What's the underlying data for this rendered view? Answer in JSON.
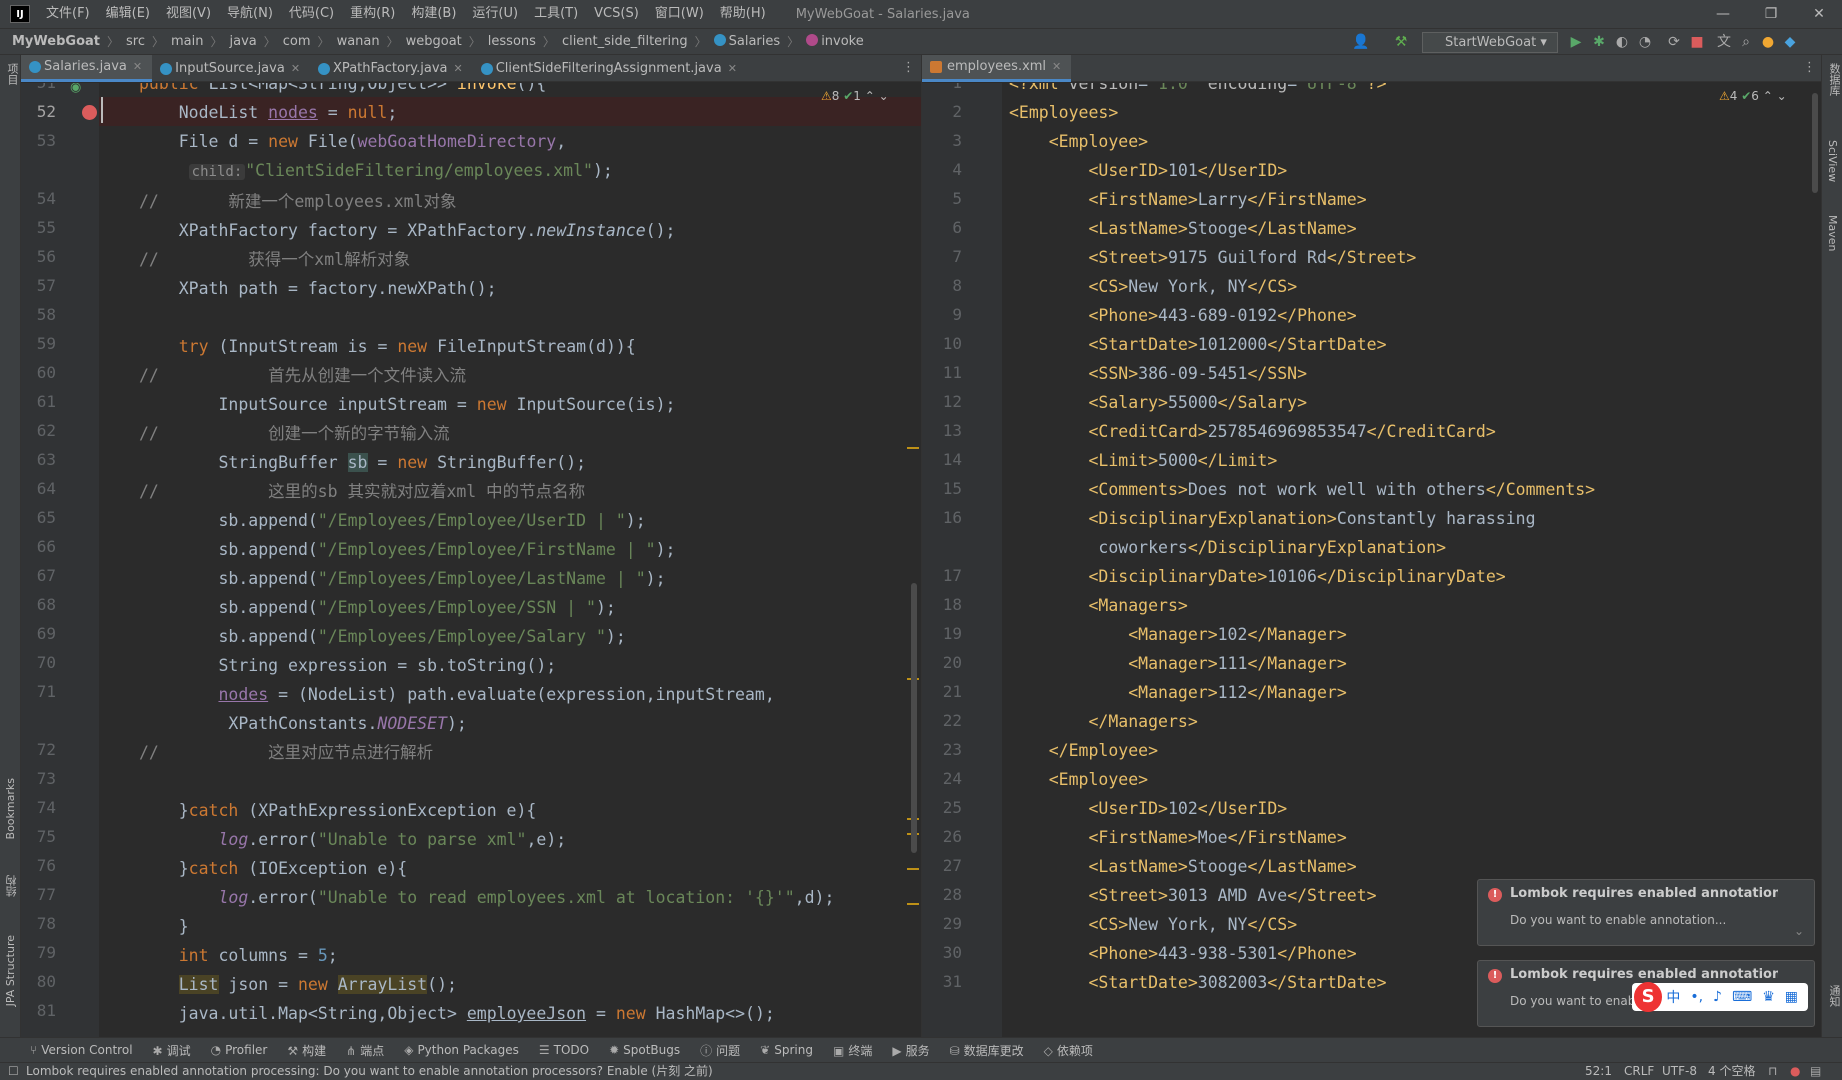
{
  "menubar": {
    "items": [
      "文件(F)",
      "编辑(E)",
      "视图(V)",
      "导航(N)",
      "代码(C)",
      "重构(R)",
      "构建(B)",
      "运行(U)",
      "工具(T)",
      "VCS(S)",
      "窗口(W)",
      "帮助(H)"
    ],
    "title": "MyWebGoat - Salaries.java"
  },
  "breadcrumbs": {
    "project": "MyWebGoat",
    "items": [
      "src",
      "main",
      "java",
      "com",
      "wanan",
      "webgoat",
      "lessons",
      "client_side_filtering"
    ],
    "class_name": "Salaries",
    "method_name": "invoke"
  },
  "toolbar": {
    "run_config": "StartWebGoat"
  },
  "left_strip": {
    "top": "项目",
    "bookmarks": "Bookmarks",
    "structure": "结构",
    "jpa": "JPA Structure"
  },
  "right_strip": {
    "db": "数据库",
    "sciview": "SciView",
    "maven": "Maven",
    "notifications": "通知"
  },
  "left_tabs": [
    {
      "label": "Salaries.java",
      "active": true
    },
    {
      "label": "InputSource.java",
      "active": false
    },
    {
      "label": "XPathFactory.java",
      "active": false
    },
    {
      "label": "ClientSideFilteringAssignment.java",
      "active": false
    }
  ],
  "right_tabs": [
    {
      "label": "employees.xml",
      "active": true
    }
  ],
  "left_editor": {
    "inspections": {
      "warnings": "8",
      "ok": "1"
    },
    "line_numbers": [
      "51",
      "52",
      "53",
      "",
      "54",
      "55",
      "56",
      "57",
      "58",
      "59",
      "60",
      "61",
      "62",
      "63",
      "64",
      "65",
      "66",
      "67",
      "68",
      "69",
      "70",
      "71",
      "",
      "72",
      "73",
      "74",
      "75",
      "76",
      "77",
      "78",
      "79",
      "80",
      "81"
    ],
    "hint_child": "child:"
  },
  "right_editor": {
    "inspections": {
      "warnings": "4",
      "ok": "6"
    },
    "line_numbers": [
      "1",
      "2",
      "3",
      "4",
      "5",
      "6",
      "7",
      "8",
      "9",
      "10",
      "11",
      "12",
      "13",
      "14",
      "15",
      "16",
      "",
      "17",
      "18",
      "19",
      "20",
      "21",
      "22",
      "23",
      "24",
      "25",
      "26",
      "27",
      "28",
      "29",
      "30",
      "31"
    ]
  },
  "notifications": [
    {
      "title": "Lombok requires enabled annotation process",
      "body": "Do you want to enable annotation..."
    },
    {
      "title": "Lombok requires enabled annotation process",
      "body": "Do you want to enable annotation..."
    }
  ],
  "ime": {
    "lang": "中"
  },
  "tool_windows": [
    "Version Control",
    "调试",
    "Profiler",
    "构建",
    "端点",
    "Python Packages",
    "TODO",
    "SpotBugs",
    "问题",
    "Spring",
    "终端",
    "服务",
    "数据库更改",
    "依赖项"
  ],
  "status": {
    "message": "Lombok requires enabled annotation processing: Do you want to enable annotation processors? Enable (片刻 之前)",
    "position": "52:1",
    "line_sep": "CRLF",
    "encoding": "UTF-8",
    "indent": "4 个空格"
  }
}
